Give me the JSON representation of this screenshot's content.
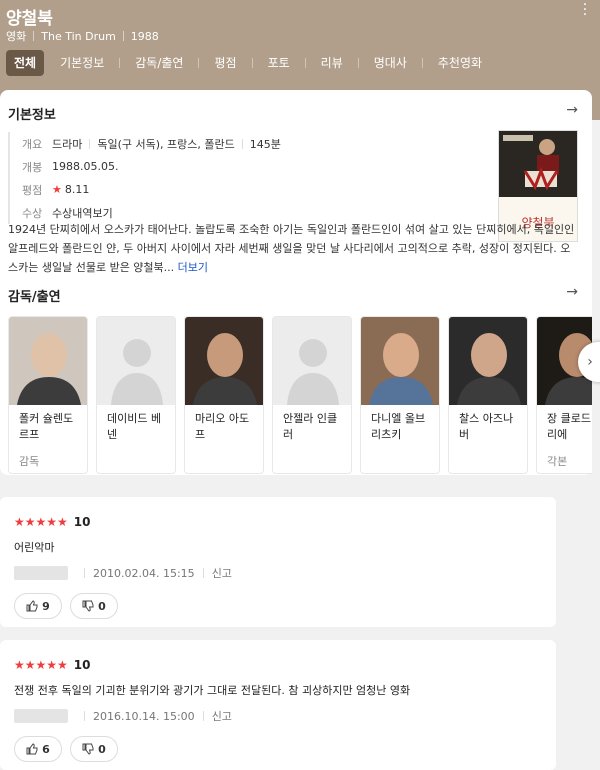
{
  "header": {
    "title": "양철북",
    "meta": [
      "영화",
      "The Tin Drum",
      "1988"
    ],
    "tabs": [
      "전체",
      "기본정보",
      "감독/출연",
      "평점",
      "포토",
      "리뷰",
      "명대사",
      "추천영화"
    ]
  },
  "basic_info": {
    "section_title": "기본정보",
    "rows": {
      "overview": {
        "label": "개요",
        "genre": "드라마",
        "country": "독일(구 서독), 프랑스, 폴란드",
        "runtime": "145분"
      },
      "release": {
        "label": "개봉",
        "value": "1988.05.05."
      },
      "rating": {
        "label": "평점",
        "star": "★",
        "value": "8.11"
      },
      "awards": {
        "label": "수상",
        "value": "수상내역보기"
      }
    },
    "poster_title": "양철북",
    "synopsis": "1924년 단찌히에서 오스카가 태어난다. 놀랍도록 조숙한 아기는 독일인과 폴란드인이 섞여 살고 있는 단찌히에서, 독일인인 알프레드와 폴란드인 얀, 두 아버지 사이에서 자라 세번째 생일을 맞던 날 사다리에서 고의적으로 추락, 성장이 정지된다. 오스카는 생일날 선물로 받은 양철북...",
    "more": "더보기"
  },
  "cast": {
    "section_title": "감독/출연",
    "people": [
      {
        "name": "폴커 슐렌도르프",
        "role": "감독",
        "photo": "photo"
      },
      {
        "name": "데이비드 베넨",
        "role": "",
        "photo": "placeholder"
      },
      {
        "name": "마리오 아도프",
        "role": "",
        "photo": "photo"
      },
      {
        "name": "안젤라 인클러",
        "role": "",
        "photo": "placeholder"
      },
      {
        "name": "다니엘 올브리츠키",
        "role": "",
        "photo": "photo"
      },
      {
        "name": "찰스 아즈나버",
        "role": "",
        "photo": "photo"
      },
      {
        "name": "장 클로드 카리에",
        "role": "각본",
        "photo": "photo"
      }
    ]
  },
  "reviews": [
    {
      "stars": "★★★★★",
      "score": "10",
      "text": "어린악마",
      "date": "2010.02.04. 15:15",
      "report": "신고",
      "likes": "9",
      "dislikes": "0"
    },
    {
      "stars": "★★★★★",
      "score": "10",
      "text": "전쟁 전후 독일의 기괴한 분위기와 광기가 그대로 전달된다. 참 괴상하지만 엄청난 영화",
      "date": "2016.10.14. 15:00",
      "report": "신고",
      "likes": "6",
      "dislikes": "0"
    }
  ],
  "colors": {
    "header_bg": "#b19f8b",
    "active_tab": "#6b5948",
    "star": "#f03c3c",
    "link": "#1a57c9"
  }
}
